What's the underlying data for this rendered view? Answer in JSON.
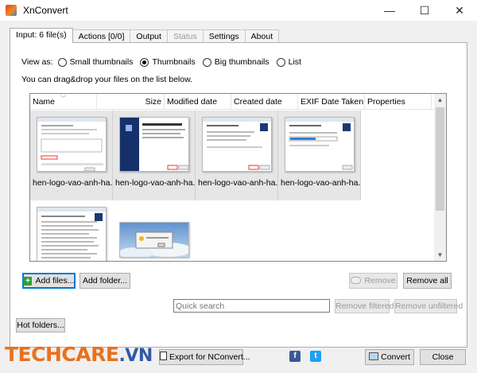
{
  "window": {
    "title": "XnConvert",
    "minimize": "—",
    "maximize": "☐",
    "close": "✕"
  },
  "tabs": [
    {
      "label": "Input: 6 file(s)",
      "active": true
    },
    {
      "label": "Actions [0/0]"
    },
    {
      "label": "Output"
    },
    {
      "label": "Status",
      "disabled": true
    },
    {
      "label": "Settings"
    },
    {
      "label": "About"
    }
  ],
  "view": {
    "label": "View as:",
    "options": [
      "Small thumbnails",
      "Thumbnails",
      "Big thumbnails",
      "List"
    ],
    "selected": "Thumbnails"
  },
  "hint": "You can drag&drop your files on the list below.",
  "columns": [
    "Name",
    "Size",
    "Modified date",
    "Created date",
    "EXIF Date Taken",
    "Properties"
  ],
  "files": [
    {
      "name": "hen-logo-vao-anh-ha.",
      "thumb": "dialog-form-icon"
    },
    {
      "name": "hen-logo-vao-anh-ha.",
      "thumb": "installer-wizard-icon"
    },
    {
      "name": "hen-logo-vao-anh-ha.",
      "thumb": "setup-dialog-icon"
    },
    {
      "name": "hen-logo-vao-anh-ha.",
      "thumb": "progress-dialog-icon"
    },
    {
      "name": "",
      "thumb": "text-document-icon"
    },
    {
      "name": "",
      "thumb": "sky-desktop-icon"
    }
  ],
  "buttons": {
    "add_files": "Add files...",
    "add_folder": "Add folder...",
    "remove": "Remove",
    "remove_all": "Remove all",
    "remove_filtered": "Remove filtered",
    "remove_unfiltered": "Remove unfiltered",
    "hot_folders": "Hot folders...",
    "export": "Export for NConvert...",
    "convert": "Convert",
    "close": "Close"
  },
  "search": {
    "placeholder": "Quick search"
  },
  "brand": {
    "main": "TECHCARE",
    "suffix": ".VN"
  },
  "social": {
    "facebook": "f",
    "twitter": "t"
  },
  "colors": {
    "brand_orange": "#e8721c",
    "brand_blue": "#2f5aa8",
    "focus": "#0078d7"
  }
}
